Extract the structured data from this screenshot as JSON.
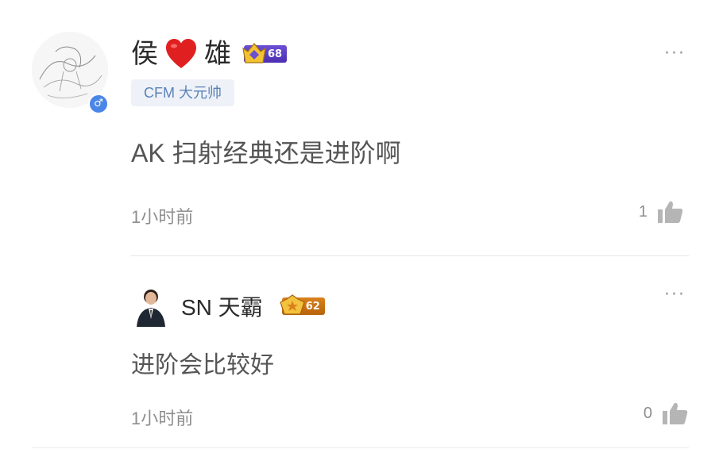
{
  "comment": {
    "author": {
      "name_first": "侯",
      "name_second": "雄",
      "heart_icon": "heart-icon",
      "level": "68",
      "gender_symbol": "♂"
    },
    "tag": "CFM 大元帅",
    "more_label": "···",
    "content": "AK 扫射经典还是进阶啊",
    "time": "1小时前",
    "likes": "1"
  },
  "reply": {
    "author": {
      "name": "SN 天霸",
      "level": "62"
    },
    "more_label": "···",
    "content": "进阶会比较好",
    "time": "1小时前",
    "likes": "0"
  },
  "colors": {
    "gender_blue": "#4a86e8",
    "tag_bg": "#eef2f8",
    "tag_text": "#5a82b8",
    "level_purple": "#5a3dc4",
    "level_orange": "#c97416",
    "heart_red": "#e02020"
  }
}
